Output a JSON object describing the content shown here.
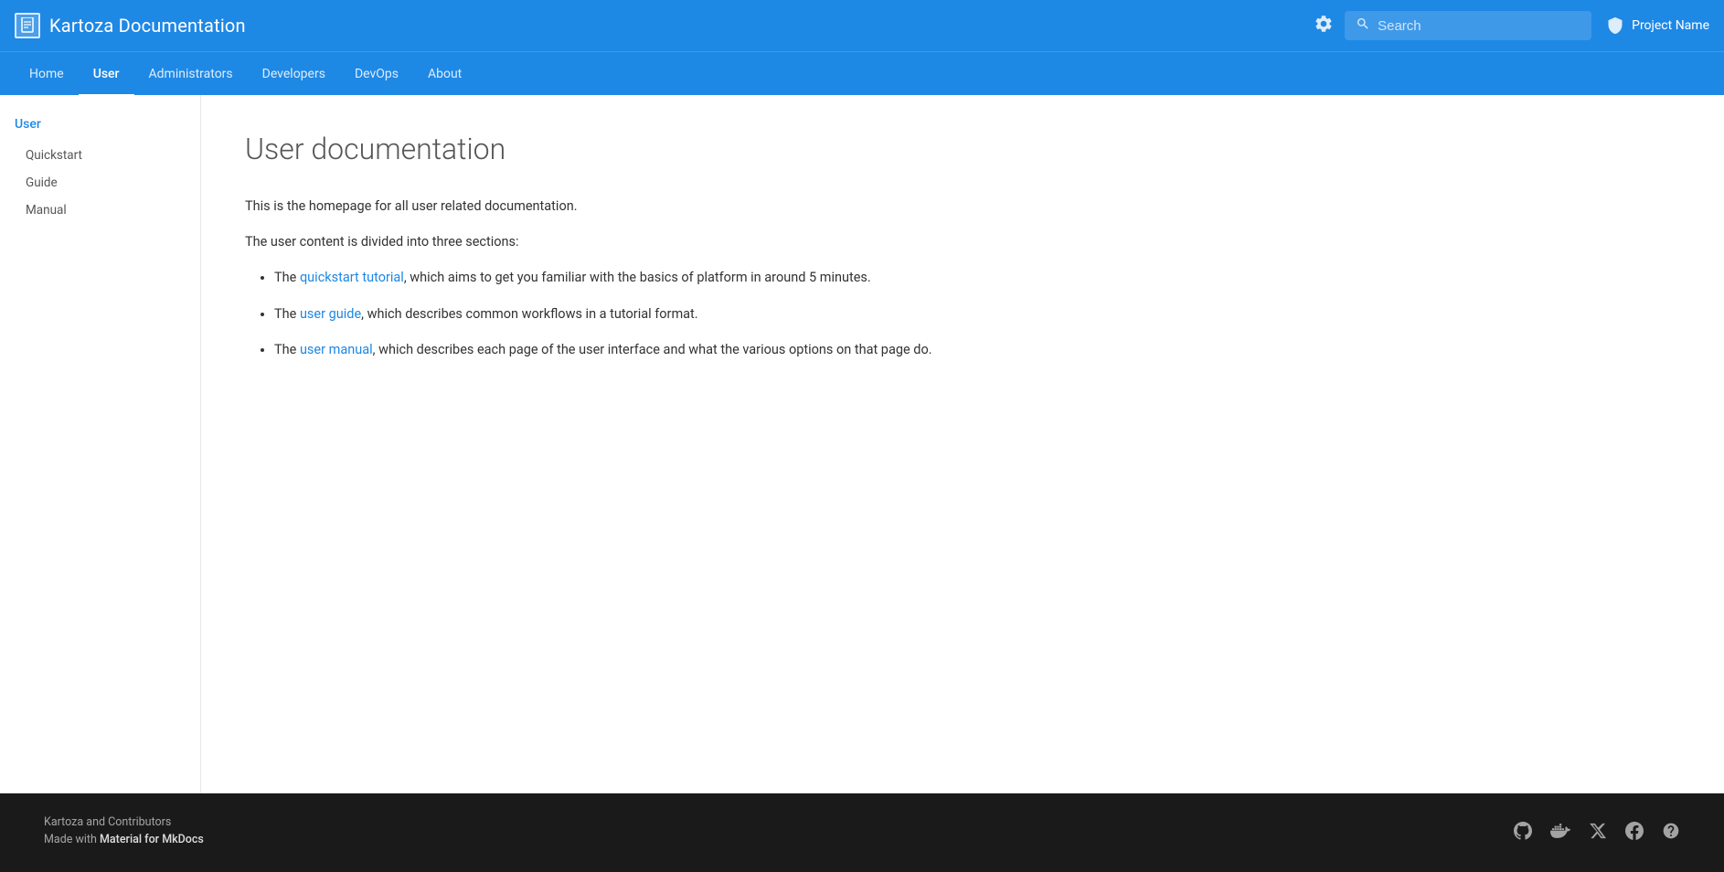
{
  "header": {
    "logo_icon": "📄",
    "title": "Kartoza Documentation",
    "search_placeholder": "Search",
    "project_name": "Project Name"
  },
  "nav": {
    "items": [
      {
        "label": "Home",
        "active": false
      },
      {
        "label": "User",
        "active": true
      },
      {
        "label": "Administrators",
        "active": false
      },
      {
        "label": "Developers",
        "active": false
      },
      {
        "label": "DevOps",
        "active": false
      },
      {
        "label": "About",
        "active": false
      }
    ]
  },
  "sidebar": {
    "section_title": "User",
    "items": [
      {
        "label": "Quickstart"
      },
      {
        "label": "Guide"
      },
      {
        "label": "Manual"
      }
    ]
  },
  "content": {
    "title": "User documentation",
    "intro": "This is the homepage for all user related documentation.",
    "sections_intro": "The user content is divided into three sections:",
    "list_items": [
      {
        "prefix": "The ",
        "link_text": "quickstart tutorial",
        "suffix": ", which aims to get you familiar with the basics of platform in around 5 minutes."
      },
      {
        "prefix": "The ",
        "link_text": "user guide",
        "suffix": ", which describes common workflows in a tutorial format."
      },
      {
        "prefix": "The ",
        "link_text": "user manual",
        "suffix": ", which describes each page of the user interface and what the various options on that page do."
      }
    ]
  },
  "footer": {
    "copyright": "Kartoza and Contributors",
    "made_with_prefix": "Made with ",
    "made_with_link": "Material for MkDocs",
    "icons": [
      {
        "name": "github",
        "symbol": "⊙"
      },
      {
        "name": "docker",
        "symbol": "🐳"
      },
      {
        "name": "twitter",
        "symbol": "𝕏"
      },
      {
        "name": "facebook",
        "symbol": "𝔽"
      },
      {
        "name": "help",
        "symbol": "?"
      }
    ]
  }
}
